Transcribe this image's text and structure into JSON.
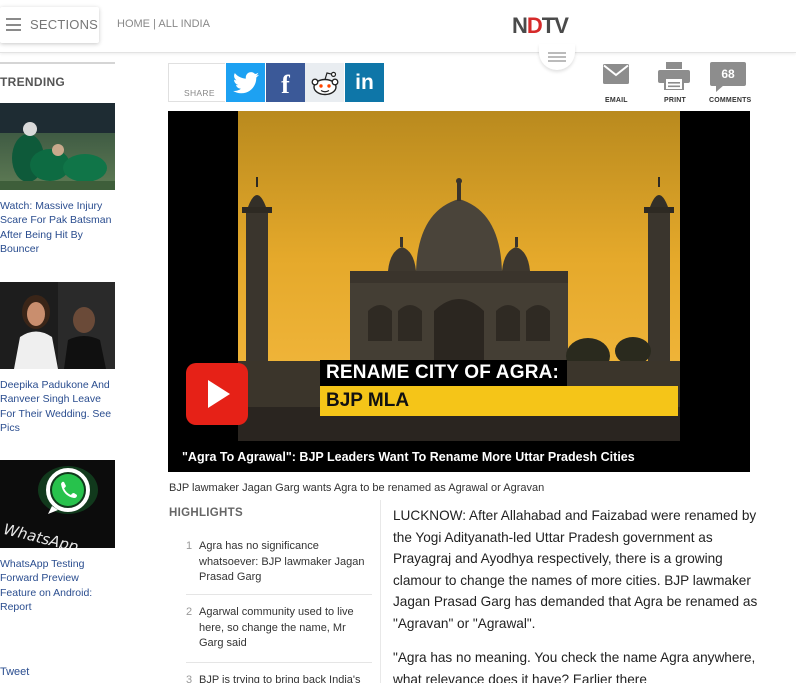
{
  "header": {
    "sections_label": "SECTIONS",
    "breadcrumb_home": "HOME",
    "breadcrumb_sep": " | ",
    "breadcrumb_region": "ALL INDIA",
    "logo_a": "N",
    "logo_b": "D",
    "logo_c": "TV"
  },
  "sidebar": {
    "title": "TRENDING",
    "items": [
      {
        "caption": "Watch: Massive Injury Scare For Pak Batsman After Being Hit By Bouncer",
        "image": "cricket-photo"
      },
      {
        "caption": "Deepika Padukone And Ranveer Singh Leave For Their Wedding. See Pics",
        "image": "celebrity-photo"
      },
      {
        "caption": "WhatsApp Testing Forward Preview Feature on Android: Report",
        "image": "whatsapp-logo",
        "logo_text": "WhatsApp"
      }
    ],
    "tweet_label": "Tweet"
  },
  "share": {
    "label": "SHARE",
    "buttons": [
      {
        "name": "twitter",
        "glyph": "twitter-bird-icon"
      },
      {
        "name": "facebook",
        "glyph": "f"
      },
      {
        "name": "reddit",
        "glyph": "reddit-alien-icon"
      },
      {
        "name": "linkedin",
        "glyph": "in"
      }
    ]
  },
  "tools": {
    "email_label": "EMAIL",
    "print_label": "PRINT",
    "comments_label": "COMMENTS",
    "comments_count": "68"
  },
  "video": {
    "overlay_line1": "RENAME CITY OF AGRA:",
    "overlay_line2": "BJP MLA",
    "title": "\"Agra To Agrawal\": BJP Leaders Want To Rename More Uttar Pradesh Cities",
    "caption": "BJP lawmaker Jagan Garg wants Agra to be renamed as Agrawal or Agravan"
  },
  "highlights": {
    "title": "HIGHLIGHTS",
    "items": [
      {
        "num": "1",
        "text": "Agra has no significance whatsoever: BJP lawmaker Jagan Prasad Garg"
      },
      {
        "num": "2",
        "text": "Agarwal community used to live here, so change the name, Mr Garg said"
      },
      {
        "num": "3",
        "text": "BJP is trying to bring back India's"
      }
    ]
  },
  "article": {
    "paragraphs": [
      "LUCKNOW: After Allahabad and Faizabad were renamed by the Yogi Adityanath-led Uttar Pradesh government as Prayagraj and Ayodhya respectively, there is a growing clamour to change the names of more cities. BJP lawmaker Jagan Prasad Garg has demanded that Agra be renamed as \"Agravan\" or \"Agrawal\".",
      "\"Agra has no meaning. You check the name Agra anywhere, what relevance does it have? Earlier there"
    ]
  },
  "colors": {
    "link_blue": "#2a4d8f",
    "twitter": "#1da1f2",
    "facebook": "#3b5998",
    "linkedin": "#0e76a8",
    "youtube_red": "#e62117",
    "overlay_yellow": "#f5c518",
    "ndtv_red": "#d62a2a"
  }
}
